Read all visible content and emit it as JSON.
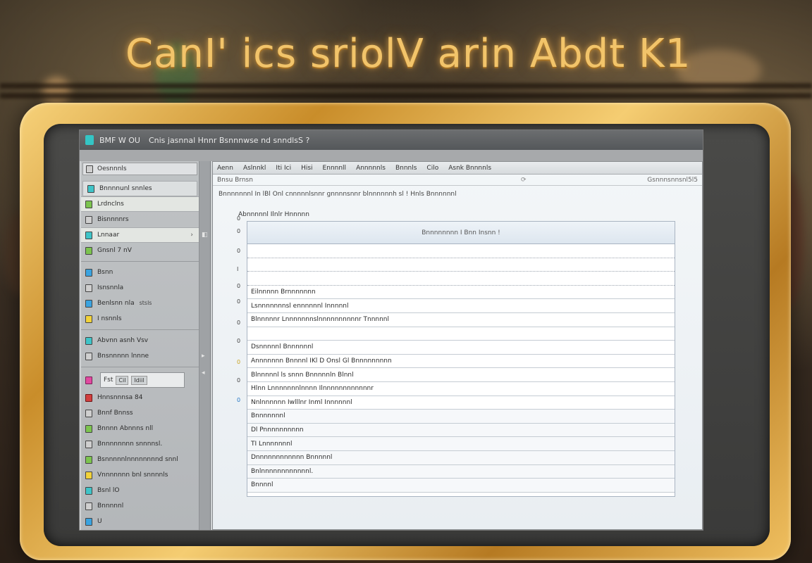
{
  "hero": {
    "title": "CanI' ics sriolV arin Abdt K1"
  },
  "window": {
    "title": "BMF W  OU",
    "caption": "Cnis jasnnal Hnnr Bsnnnwse nd snndlsS ?",
    "corner_button": "↗"
  },
  "sidebar": {
    "header": "Oesnnnls",
    "items": [
      {
        "label": "Bnnnnunl  snnles",
        "icon": "teal",
        "style": "sel"
      },
      {
        "label": "Lrdnclns",
        "icon": "green",
        "style": "hl"
      },
      {
        "label": "Bisnnnnrs",
        "icon": "gray",
        "style": ""
      },
      {
        "label": "Lnnaar",
        "icon": "teal",
        "style": "hl",
        "chevron": "›"
      },
      {
        "label": "Gnsnl 7 nV",
        "icon": "green",
        "style": ""
      },
      {
        "label": "Bsnn",
        "icon": "blue",
        "style": ""
      },
      {
        "label": "Isnsnnla",
        "icon": "gray",
        "style": ""
      },
      {
        "label": "Benlsnn nla",
        "sub": "stsls",
        "icon": "blue",
        "style": ""
      },
      {
        "label": "I nsnnls",
        "icon": "yellow",
        "style": ""
      },
      {
        "label": "Abvnn asnh Vsv",
        "icon": "teal",
        "style": ""
      },
      {
        "label": "Bnsnnnnn lnnne",
        "icon": "gray",
        "style": ""
      },
      {
        "label": "Hnnsnnnsa  84",
        "icon": "red",
        "style": ""
      },
      {
        "label": "Bnnf Bnnss",
        "icon": "gray",
        "style": ""
      },
      {
        "label": "Bnnnn Abnnns nll",
        "icon": "green",
        "style": ""
      },
      {
        "label": "Bnnnnnnnn snnnnsl.",
        "icon": "gray",
        "style": ""
      },
      {
        "label": "Bsnnnnnlnnnnnnnnd snnl",
        "icon": "green",
        "style": ""
      },
      {
        "label": "Vnnnnnnn bnl snnnnls",
        "icon": "yellow",
        "style": ""
      },
      {
        "label": "Bsnl lO",
        "icon": "teal",
        "style": ""
      },
      {
        "label": "Bnnnnnl",
        "icon": "gray",
        "style": ""
      },
      {
        "label": "U",
        "icon": "blue",
        "style": ""
      }
    ],
    "search": {
      "prefix": "Fst",
      "chip1": "Cil",
      "chip2": "Idiil"
    }
  },
  "main": {
    "tabs": [
      "Aenn",
      "Aslnnkl",
      "Iti Ici",
      "Hisi",
      "Ennnnll",
      "Annnnnls",
      "Bnnnls",
      "Cilo",
      "Asnk Bnnnnls"
    ],
    "address": {
      "left": "Bnsu Brnsn",
      "right": "Gsnnnsnnsnl5l5"
    },
    "description": "Bnnnnnnnl  In  lBl  Onl  cnnnnnlsnnr  gnnnnsnnr  blnnnnnnh  sl  !  Hnls  Bnnnnnnl",
    "breadcrumb": "Abnnnnnl  Ilnlr  Hnnnnn",
    "grid_header": "Bnnnnnnnn  I  Bnn  Insnn  !",
    "rows": [
      "",
      "",
      "",
      "Eilnnnnn  Brnnnnnnn",
      "Lsnnnnnnnsl  ennnnnnl  Innnnnl",
      "Blnnnnnr  Lnnnnnnnslnnnnnnnnnnr  Tnnnnnl",
      "",
      "Dsnnnnnl  Bnnnnnnl",
      "Annnnnnn  Bnnnnl  IKl  D  Onsl  Gl  Bnnnnnnnnn",
      "Blnnnnnl  ls  snnn  Bnnnnnln  Blnnl",
      "Hlnn  Lnnnnnnnlnnnn  Ilnnnnnnnnnnnnr",
      "Nnlnnnnnn  Iwlllnr  Inml  Innnnnnl",
      "Bnnnnnnnl",
      "Dl  Pnnnnnnnnnn",
      "TI  Lnnnnnnnl",
      "Dnnnnnnnnnnnn  Bnnnnnl",
      "Bnlnnnnnnnnnnnnl.",
      "Bnnnnl"
    ],
    "row_markers": [
      "0",
      "0",
      "0",
      "I",
      "0",
      "0",
      "0",
      "0",
      "0",
      "0",
      "0"
    ]
  }
}
